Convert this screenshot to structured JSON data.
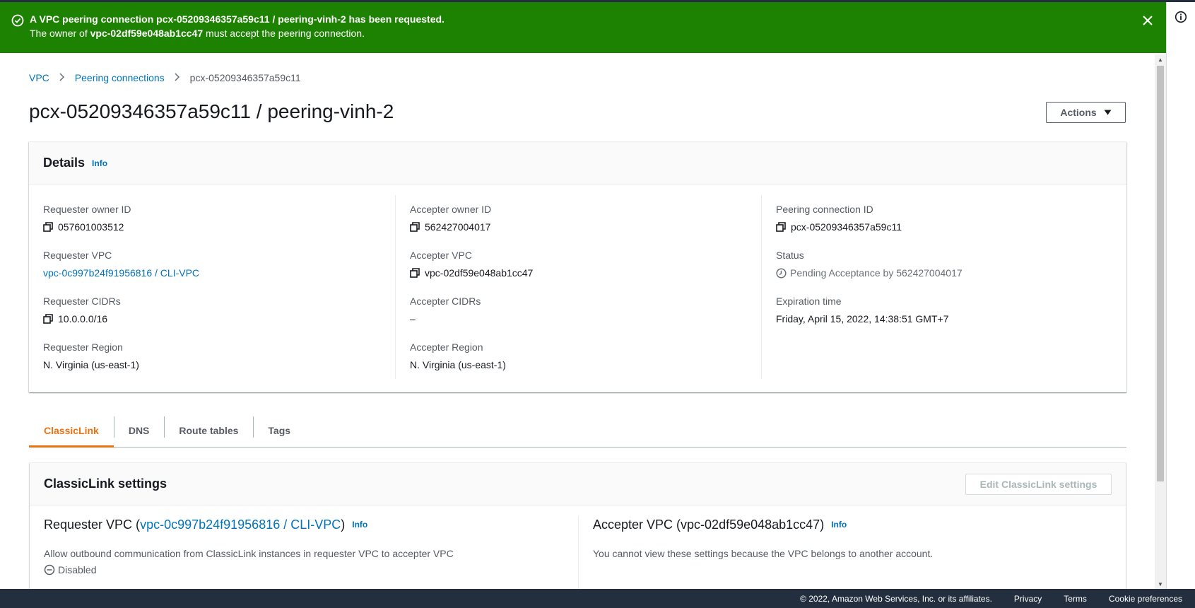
{
  "flash": {
    "line1": "A VPC peering connection pcx-05209346357a59c11 / peering-vinh-2 has been requested.",
    "line2_prefix": "The owner of ",
    "line2_vpc": "vpc-02df59e048ab1cc47",
    "line2_suffix": " must accept the peering connection.",
    "color": "#1d8102"
  },
  "breadcrumb": {
    "items": [
      "VPC",
      "Peering connections"
    ],
    "current": "pcx-05209346357a59c11"
  },
  "page": {
    "title": "pcx-05209346357a59c11 / peering-vinh-2",
    "actions_label": "Actions"
  },
  "details": {
    "title": "Details",
    "info": "Info",
    "col1": {
      "requester_owner_id_label": "Requester owner ID",
      "requester_owner_id": "057601003512",
      "requester_vpc_label": "Requester VPC",
      "requester_vpc": "vpc-0c997b24f91956816 / CLI-VPC",
      "requester_cidrs_label": "Requester CIDRs",
      "requester_cidrs": "10.0.0.0/16",
      "requester_region_label": "Requester Region",
      "requester_region": "N. Virginia (us-east-1)"
    },
    "col2": {
      "accepter_owner_id_label": "Accepter owner ID",
      "accepter_owner_id": "562427004017",
      "accepter_vpc_label": "Accepter VPC",
      "accepter_vpc": "vpc-02df59e048ab1cc47",
      "accepter_cidrs_label": "Accepter CIDRs",
      "accepter_cidrs": "–",
      "accepter_region_label": "Accepter Region",
      "accepter_region": "N. Virginia (us-east-1)"
    },
    "col3": {
      "peering_id_label": "Peering connection ID",
      "peering_id": "pcx-05209346357a59c11",
      "status_label": "Status",
      "status": "Pending Acceptance by 562427004017",
      "expiration_label": "Expiration time",
      "expiration": "Friday, April 15, 2022, 14:38:51 GMT+7"
    }
  },
  "tabs": [
    {
      "label": "ClassicLink",
      "active": true
    },
    {
      "label": "DNS",
      "active": false
    },
    {
      "label": "Route tables",
      "active": false
    },
    {
      "label": "Tags",
      "active": false
    }
  ],
  "classiclink": {
    "title": "ClassicLink settings",
    "edit_label": "Edit ClassicLink settings",
    "requester_prefix": "Requester VPC (",
    "requester_vpc_link": "vpc-0c997b24f91956816 / CLI-VPC",
    "requester_suffix": ")",
    "requester_info": "Info",
    "requester_desc": "Allow outbound communication from ClassicLink instances in requester VPC to accepter VPC",
    "requester_state": "Disabled",
    "accepter_title": "Accepter VPC (vpc-02df59e048ab1cc47)",
    "accepter_info": "Info",
    "accepter_desc": "You cannot view these settings because the VPC belongs to another account."
  },
  "footer": {
    "copyright": "© 2022, Amazon Web Services, Inc. or its affiliates.",
    "privacy": "Privacy",
    "terms": "Terms",
    "cookies": "Cookie preferences"
  }
}
